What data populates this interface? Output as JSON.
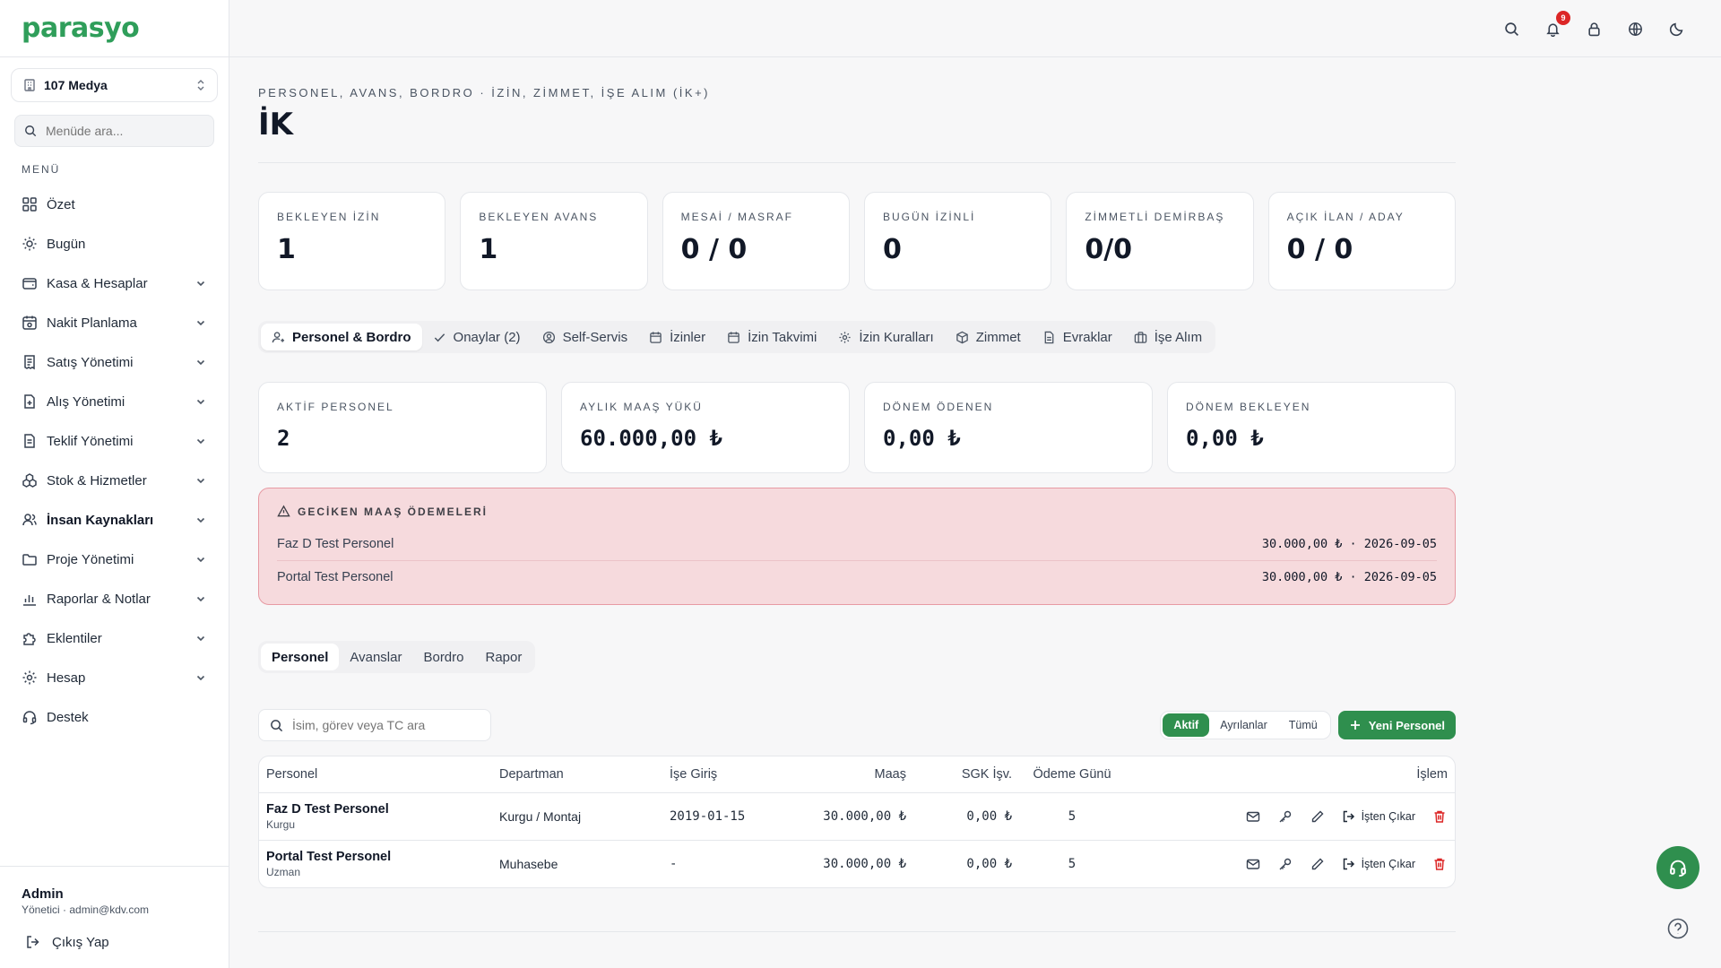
{
  "brand": {
    "logo_text": "parasyo"
  },
  "company_selector": {
    "value": "107 Medya"
  },
  "menu_search": {
    "placeholder": "Menüde ara..."
  },
  "menu": {
    "title": "MENÜ",
    "items": [
      {
        "label": "Özet",
        "icon": "grid-icon",
        "expandable": false
      },
      {
        "label": "Bugün",
        "icon": "sun-icon",
        "expandable": false
      },
      {
        "label": "Kasa & Hesaplar",
        "icon": "wallet-icon",
        "expandable": true
      },
      {
        "label": "Nakit Planlama",
        "icon": "calendar-money-icon",
        "expandable": true
      },
      {
        "label": "Satış Yönetimi",
        "icon": "receipt-icon",
        "expandable": true
      },
      {
        "label": "Alış Yönetimi",
        "icon": "file-plus-icon",
        "expandable": true
      },
      {
        "label": "Teklif Yönetimi",
        "icon": "document-icon",
        "expandable": true
      },
      {
        "label": "Stok & Hizmetler",
        "icon": "boxes-icon",
        "expandable": true
      },
      {
        "label": "İnsan Kaynakları",
        "icon": "users-icon",
        "expandable": true,
        "active": true
      },
      {
        "label": "Proje Yönetimi",
        "icon": "folder-icon",
        "expandable": true
      },
      {
        "label": "Raporlar & Notlar",
        "icon": "bar-chart-icon",
        "expandable": true
      },
      {
        "label": "Eklentiler",
        "icon": "puzzle-icon",
        "expandable": true
      },
      {
        "label": "Hesap",
        "icon": "gear-icon",
        "expandable": true
      },
      {
        "label": "Destek",
        "icon": "headset-icon",
        "expandable": false
      }
    ]
  },
  "user": {
    "name": "Admin",
    "role_email": "Yönetici · admin@kdv.com",
    "logout_label": "Çıkış Yap"
  },
  "topbar": {
    "notification_count": "9"
  },
  "page": {
    "breadcrumb": "PERSONEL, AVANS, BORDRO · İZİN, ZİMMET, İŞE ALIM (İK+)",
    "title": "İK"
  },
  "summary_cards": [
    {
      "label": "BEKLEYEN İZİN",
      "value": "1"
    },
    {
      "label": "BEKLEYEN AVANS",
      "value": "1"
    },
    {
      "label": "MESAİ / MASRAF",
      "value": "0 / 0"
    },
    {
      "label": "BUGÜN İZİNLİ",
      "value": "0"
    },
    {
      "label": "ZİMMETLİ DEMİRBAŞ",
      "value": "0/0"
    },
    {
      "label": "AÇIK İLAN / ADAY",
      "value": "0 / 0"
    }
  ],
  "main_tabs": [
    {
      "label": "Personel & Bordro",
      "icon": "user-icon",
      "active": true
    },
    {
      "label": "Onaylar (2)",
      "icon": "check-icon"
    },
    {
      "label": "Self-Servis",
      "icon": "user-circle-icon"
    },
    {
      "label": "İzinler",
      "icon": "calendar-icon"
    },
    {
      "label": "İzin Takvimi",
      "icon": "calendar-icon"
    },
    {
      "label": "İzin Kuralları",
      "icon": "gear-icon"
    },
    {
      "label": "Zimmet",
      "icon": "box-icon"
    },
    {
      "label": "Evraklar",
      "icon": "file-icon"
    },
    {
      "label": "İşe Alım",
      "icon": "briefcase-icon"
    }
  ],
  "payroll_cards": [
    {
      "label": "AKTİF PERSONEL",
      "value": "2"
    },
    {
      "label": "AYLIK MAAŞ YÜKÜ",
      "value": "60.000,00 ₺"
    },
    {
      "label": "DÖNEM ÖDENEN",
      "value": "0,00 ₺"
    },
    {
      "label": "DÖNEM BEKLEYEN",
      "value": "0,00 ₺"
    }
  ],
  "overdue_alert": {
    "title": "GECİKEN MAAŞ ÖDEMELERİ",
    "rows": [
      {
        "name": "Faz D Test Personel",
        "detail": "30.000,00 ₺ · 2026-09-05"
      },
      {
        "name": "Portal Test Personel",
        "detail": "30.000,00 ₺ · 2026-09-05"
      }
    ]
  },
  "sub_tabs": [
    {
      "label": "Personel",
      "active": true
    },
    {
      "label": "Avanslar"
    },
    {
      "label": "Bordro"
    },
    {
      "label": "Rapor"
    }
  ],
  "staff_search": {
    "placeholder": "İsim, görev veya TC ara"
  },
  "filter": {
    "options": [
      "Aktif",
      "Ayrılanlar",
      "Tümü"
    ],
    "selected": "Aktif"
  },
  "new_button": {
    "label": "Yeni Personel"
  },
  "table": {
    "columns": [
      "Personel",
      "Departman",
      "İşe Giriş",
      "Maaş",
      "SGK İşv.",
      "Ödeme Günü",
      "İşlem"
    ],
    "exit_label": "İşten Çıkar",
    "rows": [
      {
        "name": "Faz D Test Personel",
        "role": "Kurgu",
        "department": "Kurgu / Montaj",
        "start": "2019-01-15",
        "salary": "30.000,00 ₺",
        "sgk": "0,00 ₺",
        "pay_day": "5"
      },
      {
        "name": "Portal Test Personel",
        "role": "Uzman",
        "department": "Muhasebe",
        "start": "-",
        "salary": "30.000,00 ₺",
        "sgk": "0,00 ₺",
        "pay_day": "5"
      }
    ]
  },
  "colors": {
    "brand_green": "#2f9e5a",
    "button_green": "#2f8f4e",
    "alert_bg": "#f6dadd",
    "alert_border": "#e79aa3",
    "danger": "#dc2626"
  }
}
